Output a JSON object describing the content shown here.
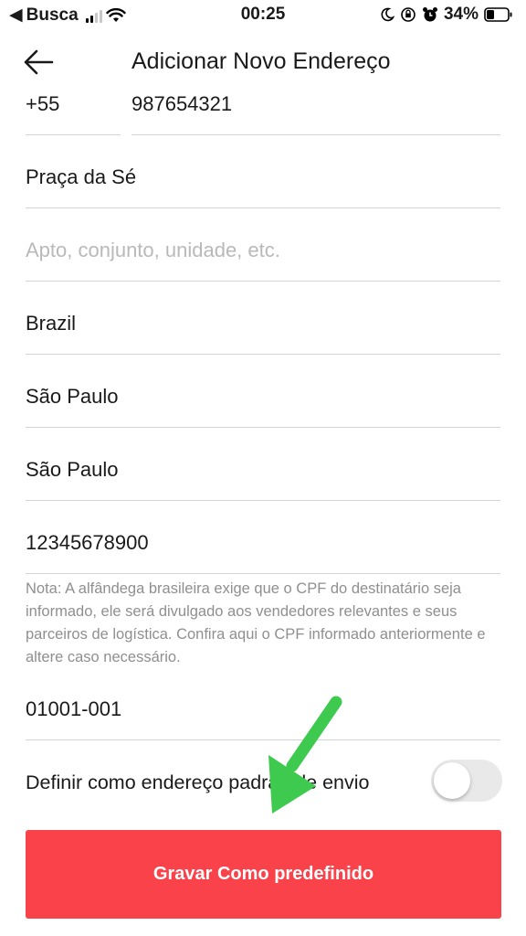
{
  "status_bar": {
    "carrier": "Busca",
    "time": "00:25",
    "battery": "34%"
  },
  "header": {
    "title": "Adicionar Novo Endereço"
  },
  "form": {
    "country_code": "+55",
    "phone": "987654321",
    "street": "Praça da Sé",
    "complement_placeholder": "Apto, conjunto, unidade, etc.",
    "country": "Brazil",
    "state": "São Paulo",
    "city": "São Paulo",
    "cpf": "12345678900",
    "cpf_note": "Nota: A alfândega brasileira exige que o CPF do destinatário seja informado, ele será divulgado aos vendedores relevantes e seus parceiros de logística. Confira aqui o CPF informado anteriormente e altere caso necessário.",
    "zip": "01001-001",
    "default_label": "Definir como endereço padrão de envio",
    "default_enabled": false
  },
  "save_button": {
    "label": "Gravar Como predefinido"
  },
  "colors": {
    "accent": "#f94249",
    "annotation_arrow": "#3ec94f"
  }
}
